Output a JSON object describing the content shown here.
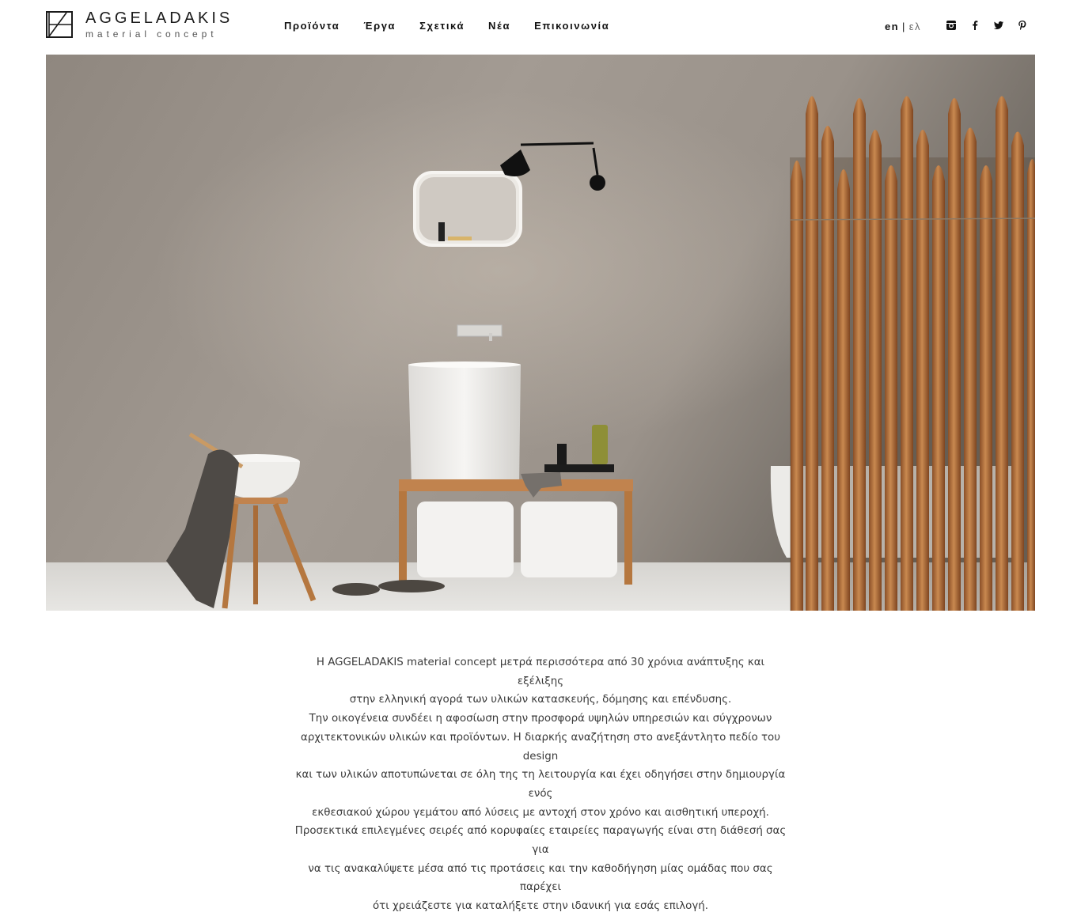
{
  "brand": {
    "title": "AGGELADAKIS",
    "subtitle": "material concept"
  },
  "nav": {
    "items": [
      {
        "label": "Προϊόντα"
      },
      {
        "label": "Έργα"
      },
      {
        "label": "Σχετικά"
      },
      {
        "label": "Νέα"
      },
      {
        "label": "Επικοινωνία"
      }
    ]
  },
  "language": {
    "active": "en",
    "separator": "|",
    "inactive": "ελ"
  },
  "social": {
    "icons": [
      "instagram-icon",
      "facebook-icon",
      "twitter-icon",
      "pinterest-icon"
    ]
  },
  "intro": {
    "lines": [
      "Η AGGELADAKIS material concept μετρά περισσότερα από 30 χρόνια ανάπτυξης και εξέλιξης",
      "στην ελληνική αγορά των υλικών κατασκευής, δόμησης και επένδυσης.",
      "Την οικογένεια συνδέει η αφοσίωση στην προσφορά υψηλών υπηρεσιών και σύγχρονων",
      "αρχιτεκτονικών υλικών και προϊόντων. Η διαρκής αναζήτηση στο ανεξάντλητο πεδίο του design",
      "και των υλικών αποτυπώνεται σε όλη της τη λειτουργία και έχει οδηγήσει στην δημιουργία ενός",
      "εκθεσιακού χώρου γεμάτου από λύσεις με αντοχή στον χρόνο και αισθητική υπεροχή.",
      "Προσεκτικά επιλεγμένες σειρές από κορυφαίες εταιρείες παραγωγής είναι στη διάθεσή σας για",
      "να τις ανακαλύψετε μέσα από τις προτάσεις και την καθοδήγηση μίας ομάδας που σας παρέχει",
      "ότι χρειάζεστε για καταλήξετε στην ιδανική για εσάς επιλογή."
    ]
  },
  "colors": {
    "wall": "#9c948b",
    "floor": "#dcdad6",
    "wood": "#b9743f",
    "ceramic": "#f2f1ef"
  }
}
